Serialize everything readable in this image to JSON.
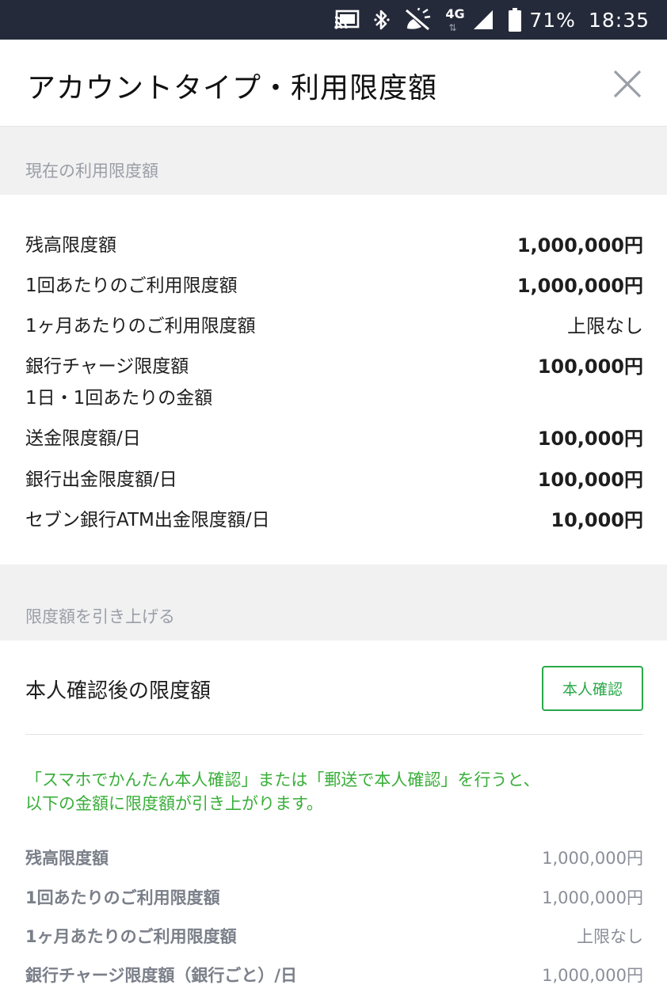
{
  "status_bar": {
    "battery_percent": "71%",
    "time": "18:35",
    "network_label": "4G",
    "icons": [
      "cast-icon",
      "bluetooth-icon",
      "vibrate-off-icon",
      "network-4g-icon",
      "signal-icon",
      "battery-icon"
    ]
  },
  "header": {
    "title": "アカウントタイプ・利用限度額",
    "close_icon": "close-icon"
  },
  "current": {
    "section_title": "現在の利用限度額",
    "items": [
      {
        "label": "残高限度額",
        "value": "1,000,000円"
      },
      {
        "label": "1回あたりのご利用限度額",
        "value": "1,000,000円"
      },
      {
        "label": "1ヶ月あたりのご利用限度額",
        "value": "上限なし"
      },
      {
        "label": "銀行チャージ限度額",
        "sublabel": "1日・1回あたりの金額",
        "value": "100,000円"
      },
      {
        "label": "送金限度額/日",
        "value": "100,000円"
      },
      {
        "label": "銀行出金限度額/日",
        "value": "100,000円"
      },
      {
        "label": "セブン銀行ATM出金限度額/日",
        "value": "10,000円"
      }
    ]
  },
  "raise": {
    "section_title": "限度額を引き上げる",
    "card_title": "本人確認後の限度額",
    "verify_button": "本人確認",
    "notice_line1": "「スマホでかんたん本人確認」または「郵送で本人確認」を行うと、",
    "notice_line2": "以下の金額に限度額が引き上がります。",
    "items": [
      {
        "label": "残高限度額",
        "value": "1,000,000円"
      },
      {
        "label": "1回あたりのご利用限度額",
        "value": "1,000,000円"
      },
      {
        "label": "1ヶ月あたりのご利用限度額",
        "value": "上限なし"
      },
      {
        "label": "銀行チャージ限度額（銀行ごと）/日",
        "value": "1,000,000円"
      }
    ]
  },
  "colors": {
    "status_bar_bg": "#252a3a",
    "section_bg": "#f1f1f2",
    "accent_green": "#2aa84a"
  }
}
